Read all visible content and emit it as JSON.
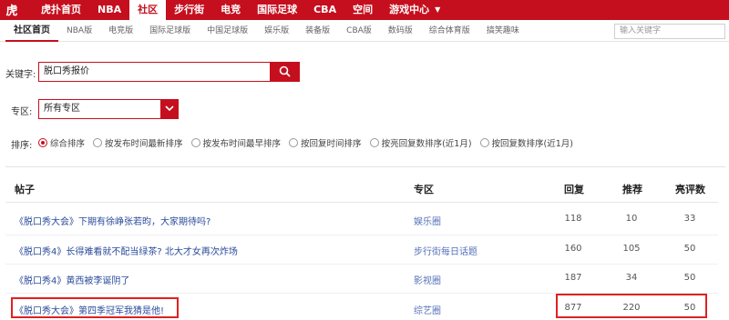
{
  "topnav": {
    "logo_text": "虎扑",
    "items": [
      {
        "label": "虎扑首页"
      },
      {
        "label": "NBA"
      },
      {
        "label": "社区",
        "active": true
      },
      {
        "label": "步行街"
      },
      {
        "label": "电竞"
      },
      {
        "label": "国际足球"
      },
      {
        "label": "CBA"
      },
      {
        "label": "空间"
      },
      {
        "label": "游戏中心"
      }
    ],
    "accent_color": "#c50f1e"
  },
  "subnav": {
    "items": [
      {
        "label": "社区首页",
        "active": true
      },
      {
        "label": "NBA版"
      },
      {
        "label": "电竞版"
      },
      {
        "label": "国际足球版"
      },
      {
        "label": "中国足球版"
      },
      {
        "label": "娱乐版"
      },
      {
        "label": "装备版"
      },
      {
        "label": "CBA版"
      },
      {
        "label": "数码版"
      },
      {
        "label": "综合体育版"
      },
      {
        "label": "搞笑趣味"
      }
    ],
    "search_placeholder": "输入关键字"
  },
  "search": {
    "keyword_label": "关键字:",
    "keyword_value": "脱口秀报价",
    "zone_label": "专区:",
    "zone_value": "所有专区",
    "sort_label": "排序:",
    "sort_options": [
      {
        "label": "综合排序",
        "checked": true
      },
      {
        "label": "按发布时间最新排序"
      },
      {
        "label": "按发布时间最早排序"
      },
      {
        "label": "按回复时间排序"
      },
      {
        "label": "按亮回复数排序(近1月)"
      },
      {
        "label": "按回复数排序(近1月)"
      }
    ]
  },
  "table": {
    "headers": {
      "title": "帖子",
      "zone": "专区",
      "replies": "回复",
      "recommend": "推荐",
      "highlights": "亮评数"
    },
    "rows": [
      {
        "title": "《脱口秀大会》下期有徐峥张若昀，大家期待吗?",
        "zone": "娱乐圈",
        "replies": "118",
        "recommend": "10",
        "highlights": "33"
      },
      {
        "title": "《脱口秀4》长得难看就不配当绿茶? 北大才女再次炸场",
        "zone": "步行街每日话题",
        "replies": "160",
        "recommend": "105",
        "highlights": "50"
      },
      {
        "title": "《脱口秀4》黄西被李诞阴了",
        "zone": "影视圈",
        "replies": "187",
        "recommend": "34",
        "highlights": "50"
      },
      {
        "title": "《脱口秀大会》第四季冠军我猜是他!",
        "zone": "综艺圈",
        "replies": "877",
        "recommend": "220",
        "highlights": "50"
      }
    ]
  }
}
